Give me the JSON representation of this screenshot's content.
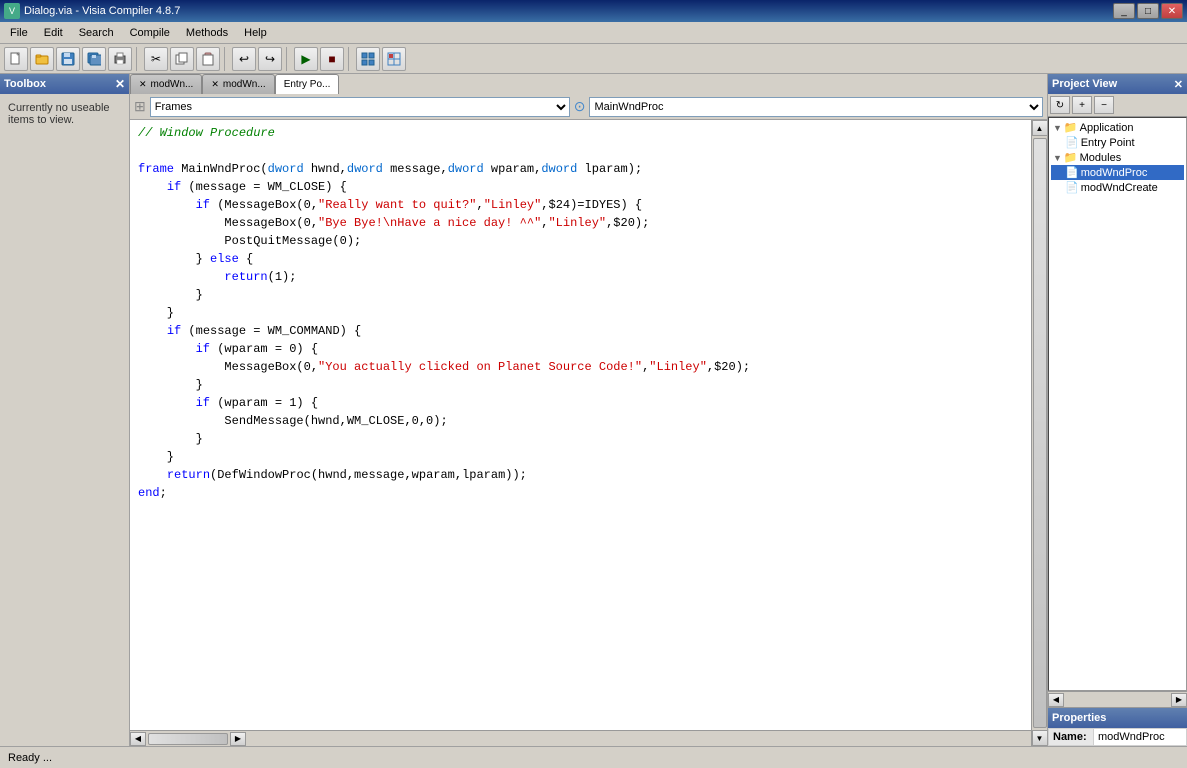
{
  "window": {
    "title": "Dialog.via - Visia Compiler 4.8.7",
    "icon": "V"
  },
  "menu": {
    "items": [
      "File",
      "Edit",
      "Search",
      "Compile",
      "Methods",
      "Help"
    ]
  },
  "toolbar": {
    "buttons": [
      {
        "name": "new",
        "icon": "🗋"
      },
      {
        "name": "open",
        "icon": "📂"
      },
      {
        "name": "save",
        "icon": "💾"
      },
      {
        "name": "save-all",
        "icon": "💾"
      },
      {
        "name": "print",
        "icon": "🖨"
      },
      {
        "sep": true
      },
      {
        "name": "cut",
        "icon": "✂"
      },
      {
        "name": "copy",
        "icon": "📋"
      },
      {
        "name": "paste",
        "icon": "📌"
      },
      {
        "sep": true
      },
      {
        "name": "undo",
        "icon": "↩"
      },
      {
        "name": "redo",
        "icon": "↪"
      },
      {
        "sep": true
      },
      {
        "name": "run",
        "icon": "▶"
      },
      {
        "name": "stop",
        "icon": "■"
      },
      {
        "sep": true
      },
      {
        "name": "toggle1",
        "icon": "⊞"
      },
      {
        "name": "toggle2",
        "icon": "⊠"
      }
    ]
  },
  "toolbox": {
    "title": "Toolbox",
    "message": "Currently no useable items to view."
  },
  "editor": {
    "tabs": [
      {
        "label": "modWndProc",
        "active": false,
        "closeable": true
      },
      {
        "label": "modWndCreate",
        "active": false,
        "closeable": true
      },
      {
        "label": "Entry Po...",
        "active": true,
        "closeable": false
      }
    ],
    "frames_label": "Frames",
    "frames_value": "Frames",
    "proc_value": "MainWndProc",
    "code_lines": [
      {
        "type": "comment",
        "text": "// Window Procedure"
      },
      {
        "type": "blank"
      },
      {
        "type": "mixed",
        "parts": [
          {
            "c": "keyword",
            "t": "frame"
          },
          {
            "c": "normal",
            "t": " MainWndProc("
          },
          {
            "c": "type",
            "t": "dword"
          },
          {
            "c": "normal",
            "t": " hwnd,"
          },
          {
            "c": "type",
            "t": "dword"
          },
          {
            "c": "normal",
            "t": " message,"
          },
          {
            "c": "type",
            "t": "dword"
          },
          {
            "c": "normal",
            "t": " wparam,"
          },
          {
            "c": "type",
            "t": "dword"
          },
          {
            "c": "normal",
            "t": " lparam);"
          }
        ]
      },
      {
        "type": "mixed",
        "indent": 1,
        "parts": [
          {
            "c": "keyword",
            "t": "if"
          },
          {
            "c": "normal",
            "t": " (message = WM_CLOSE) {"
          }
        ]
      },
      {
        "type": "mixed",
        "indent": 2,
        "parts": [
          {
            "c": "keyword",
            "t": "if"
          },
          {
            "c": "normal",
            "t": " (MessageBox(0,"
          },
          {
            "c": "string",
            "t": "\"Really want to quit?\""
          },
          {
            "c": "normal",
            "t": ","
          },
          {
            "c": "string",
            "t": "\"Linley\""
          },
          {
            "c": "normal",
            "t": ",$24)=IDYES) {"
          }
        ]
      },
      {
        "type": "mixed",
        "indent": 3,
        "parts": [
          {
            "c": "normal",
            "t": "MessageBox(0,"
          },
          {
            "c": "string",
            "t": "\"Bye Bye!\\nHave a nice day! ^^\""
          },
          {
            "c": "normal",
            "t": ","
          },
          {
            "c": "string",
            "t": "\"Linley\""
          },
          {
            "c": "normal",
            "t": ",$20);"
          }
        ]
      },
      {
        "type": "mixed",
        "indent": 3,
        "parts": [
          {
            "c": "normal",
            "t": "PostQuitMessage(0);"
          }
        ]
      },
      {
        "type": "mixed",
        "indent": 2,
        "parts": [
          {
            "c": "normal",
            "t": "} "
          },
          {
            "c": "keyword",
            "t": "else"
          },
          {
            "c": "normal",
            "t": " {"
          }
        ]
      },
      {
        "type": "mixed",
        "indent": 3,
        "parts": [
          {
            "c": "keyword",
            "t": "return"
          },
          {
            "c": "normal",
            "t": "(1);"
          }
        ]
      },
      {
        "type": "normal",
        "indent": 2,
        "text": "}"
      },
      {
        "type": "normal",
        "indent": 1,
        "text": "}"
      },
      {
        "type": "mixed",
        "indent": 1,
        "parts": [
          {
            "c": "keyword",
            "t": "if"
          },
          {
            "c": "normal",
            "t": " (message = WM_COMMAND) {"
          }
        ]
      },
      {
        "type": "mixed",
        "indent": 2,
        "parts": [
          {
            "c": "keyword",
            "t": "if"
          },
          {
            "c": "normal",
            "t": " (wparam = 0) {"
          }
        ]
      },
      {
        "type": "mixed",
        "indent": 3,
        "parts": [
          {
            "c": "normal",
            "t": "MessageBox(0,"
          },
          {
            "c": "string",
            "t": "\"You actually clicked on Planet Source Code!\""
          },
          {
            "c": "normal",
            "t": ","
          },
          {
            "c": "string",
            "t": "\"Linley\""
          },
          {
            "c": "normal",
            "t": ",$20);"
          }
        ]
      },
      {
        "type": "normal",
        "indent": 2,
        "text": "}"
      },
      {
        "type": "mixed",
        "indent": 2,
        "parts": [
          {
            "c": "keyword",
            "t": "if"
          },
          {
            "c": "normal",
            "t": " (wparam = 1) {"
          }
        ]
      },
      {
        "type": "mixed",
        "indent": 3,
        "parts": [
          {
            "c": "normal",
            "t": "SendMessage(hwnd,WM_CLOSE,0,0);"
          }
        ]
      },
      {
        "type": "normal",
        "indent": 2,
        "text": "}"
      },
      {
        "type": "normal",
        "indent": 1,
        "text": "}"
      },
      {
        "type": "mixed",
        "indent": 1,
        "parts": [
          {
            "c": "keyword",
            "t": "return"
          },
          {
            "c": "normal",
            "t": "(DefWindowProc(hwnd,message,wparam,lparam));"
          }
        ]
      },
      {
        "type": "keyword",
        "text": "end;"
      }
    ]
  },
  "project_view": {
    "title": "Project View",
    "tree": [
      {
        "label": "Application",
        "type": "folder",
        "indent": 0,
        "expanded": true
      },
      {
        "label": "Entry Point",
        "type": "file",
        "indent": 1,
        "expanded": false
      },
      {
        "label": "Modules",
        "type": "folder",
        "indent": 0,
        "expanded": true
      },
      {
        "label": "modWndProc",
        "type": "file",
        "indent": 1,
        "selected": true
      },
      {
        "label": "modWndCreate",
        "type": "file",
        "indent": 1
      }
    ]
  },
  "properties": {
    "title": "Properties",
    "rows": [
      {
        "name": "Name:",
        "value": "modWndProc"
      }
    ]
  },
  "status": {
    "text": "Ready  ..."
  },
  "code_tabs_top": [
    {
      "label": "modWn...",
      "active": false
    },
    {
      "label": "modWn...",
      "active": false
    },
    {
      "label": "Entry Po...",
      "active": true
    }
  ]
}
